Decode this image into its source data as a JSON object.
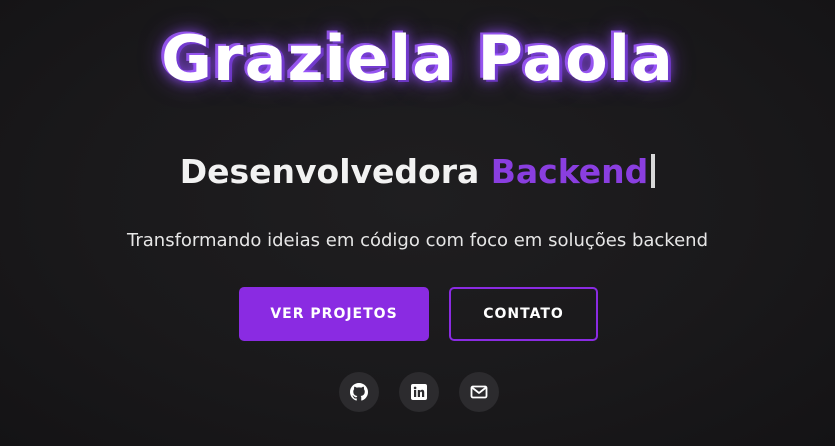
{
  "hero": {
    "name": "Graziela Paola",
    "subtitle_prefix": "Desenvolvedora",
    "subtitle_accent": "Backend",
    "tagline": "Transformando ideias em código com foco em soluções backend"
  },
  "buttons": {
    "projects_label": "VER PROJETOS",
    "contact_label": "CONTATO"
  },
  "social": [
    {
      "icon": "github-icon"
    },
    {
      "icon": "linkedin-icon"
    },
    {
      "icon": "mail-icon"
    }
  ],
  "colors": {
    "accent": "#8a2be2",
    "background": "#1a191b",
    "icon_bg": "#2c2b2e"
  }
}
